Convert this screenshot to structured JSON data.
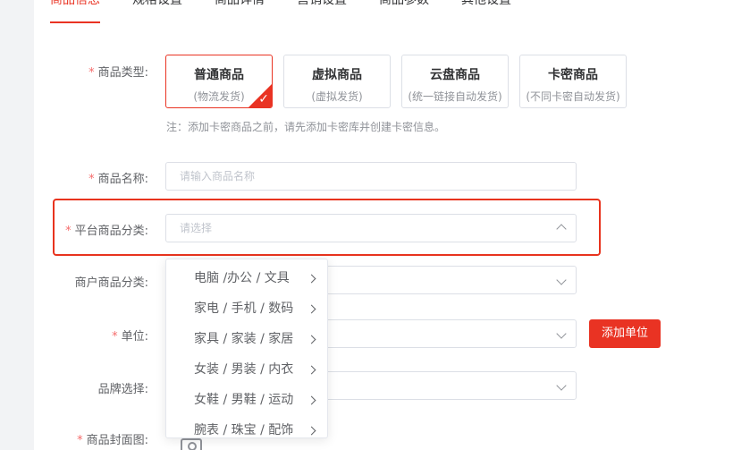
{
  "tabs": [
    "商品信息",
    "规格设置",
    "商品详情",
    "营销设置",
    "商品参数",
    "其他设置"
  ],
  "form": {
    "product_type_label": "商品类型:",
    "product_types": [
      {
        "title": "普通商品",
        "sub": "(物流发货)"
      },
      {
        "title": "虚拟商品",
        "sub": "(虚拟发货)"
      },
      {
        "title": "云盘商品",
        "sub": "(统一链接自动发货)"
      },
      {
        "title": "卡密商品",
        "sub": "(不同卡密自动发货)"
      }
    ],
    "type_note": "注：添加卡密商品之前，请先添加卡密库并创建卡密信息。",
    "name_label": "商品名称:",
    "name_placeholder": "请输入商品名称",
    "platform_category_label": "平台商品分类:",
    "platform_category_placeholder": "请选择",
    "merchant_category_label": "商户商品分类:",
    "unit_label": "单位:",
    "add_unit_button": "添加单位",
    "brand_label": "品牌选择:",
    "cover_label": "商品封面图:"
  },
  "category_dropdown": [
    "电脑 /办公 / 文具",
    "家电 / 手机 / 数码",
    "家具 / 家装 / 家居",
    "女装 / 男装 / 内衣",
    "女鞋 / 男鞋 / 运动",
    "腕表 / 珠宝 / 配饰"
  ],
  "colors": {
    "accent": "#e93323",
    "highlight": "#e8331e"
  },
  "icons": {
    "selected_check": "checkmark-icon",
    "dropdown_open": "chevron-up-icon",
    "dropdown_closed": "chevron-down-icon",
    "submenu": "chevron-right-icon",
    "upload": "camera-icon"
  }
}
